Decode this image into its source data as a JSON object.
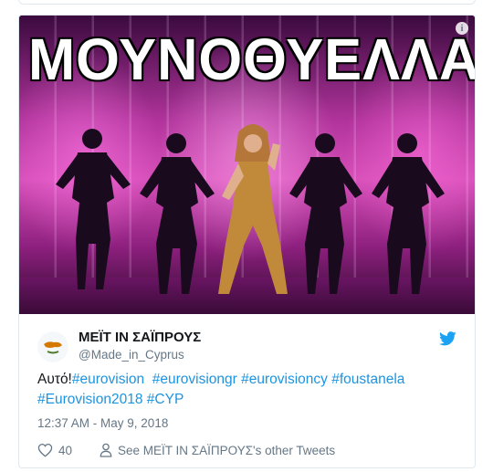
{
  "media": {
    "banner_text": "ΜΟΥΝΟΘΥΕΛΛΑ",
    "info_icon": "info-icon"
  },
  "author": {
    "name": "ΜΕΪΤ ΙΝ ΣΑΪΠΡΟΥΣ",
    "handle": "@Made_in_Cyprus",
    "avatar_icon": "cyprus-flag-avatar",
    "platform_icon": "twitter-bird-icon"
  },
  "tweet": {
    "prefix": "Αυτό!",
    "hashtags_line1": [
      "#eurovision",
      "#eurovisiongr",
      "#eurovisioncy",
      "#foustanela"
    ],
    "hashtags_line2": [
      "#Eurovision2018",
      "#CYP"
    ],
    "timestamp": "12:37 AM - May 9, 2018"
  },
  "actions": {
    "like_count": "40",
    "other_tweets_label": "See ΜΕΪΤ ΙΝ ΣΑΪΠΡΟΥΣ's other Tweets"
  },
  "colors": {
    "link": "#1c94e0",
    "text": "#14171a",
    "muted": "#657786",
    "border": "#e1e8ed",
    "twitter_blue": "#1da1f2"
  }
}
